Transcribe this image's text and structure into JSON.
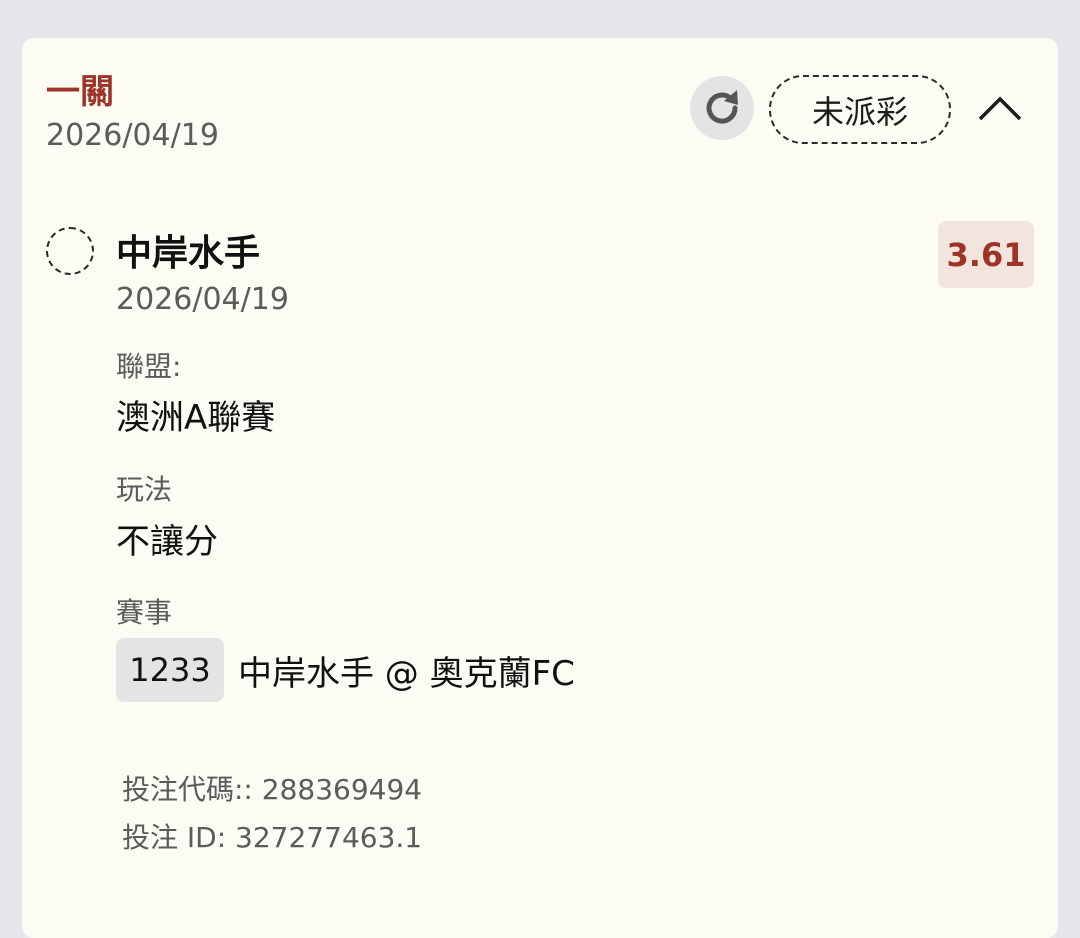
{
  "bet": {
    "type": "一關",
    "date": "2026/04/19",
    "status": "未派彩"
  },
  "icons": {
    "refresh": "refresh-icon",
    "collapse": "chevron-up-icon",
    "selection": "dashed-circle-icon"
  },
  "selection": {
    "team": "中岸水手",
    "date": "2026/04/19",
    "odds": "3.61",
    "league_label": "聯盟:",
    "league": "澳洲A聯賽",
    "market_label": "玩法",
    "market": "不讓分",
    "event_label": "賽事",
    "event_code": "1233",
    "event_name": "中岸水手 @ 奧克蘭FC"
  },
  "footer": {
    "bet_code": "投注代碼:: 288369494",
    "bet_id": "投注 ID: 327277463.1"
  },
  "colors": {
    "accent": "#9e3428",
    "card_bg": "#fcfbf4",
    "page_bg": "#e5e6e9",
    "odds_bg": "#f2e5de"
  }
}
